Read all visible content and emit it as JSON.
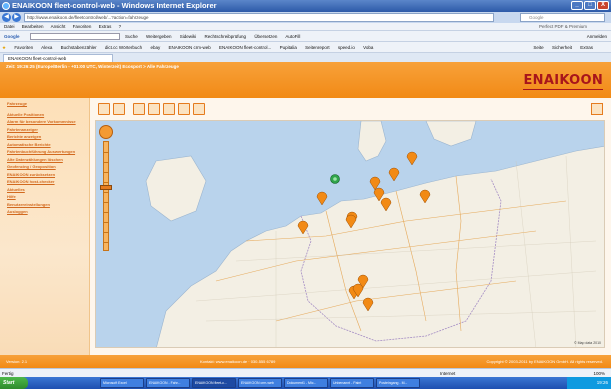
{
  "window": {
    "title": "ENAIKOON fleet-control-web - Windows Internet Explorer",
    "minimize": "_",
    "maximize": "□",
    "close": "X"
  },
  "address": {
    "url": "http://www.enaikoon.de/fleetcontrol/web/...?action=fahrzeuge",
    "search_placeholder": "Google"
  },
  "menu": {
    "items": [
      "Datei",
      "Bearbeiten",
      "Ansicht",
      "Favoriten",
      "Extras",
      "?"
    ],
    "pdf_label": "Perfect PDF & Premium"
  },
  "google_toolbar": {
    "label": "Google",
    "items": [
      "Suche",
      "Weitergeben",
      "Sidewiki",
      "Rechtschreibprüfung",
      "Übersetzen",
      "AutoFill"
    ],
    "signin": "Anmelden"
  },
  "favorites": {
    "items": [
      "Favoriten",
      "Alexa",
      "Buchstabenzähler",
      "dict.cc Wörterbuch",
      "ebay",
      "ENAIKOON crm-web",
      "ENAIKOON fleet-control...",
      "Pupitalia",
      "Seitenreport",
      "speed.io",
      "Voba"
    ],
    "right_items": [
      "Seite",
      "Sicherheit",
      "Extras"
    ]
  },
  "tab": {
    "label": "ENAIKOON fleet-control-web"
  },
  "header": {
    "time_text": "Zeit: 19:26:25 (Europe/Berlin - +01:00 UTC, Winterzeit)   Ecosport > Alle Fahrzeuge",
    "logo": "ENAIKOON"
  },
  "sidebar": {
    "items": [
      "Fahrzeuge",
      "Aktuelle Positionen",
      "Alarm für besondere Vorkommnisse",
      "Fahrtenanzeiger",
      "Berichte anzeigen",
      "Automatische Berichte",
      "Fahrtenbuchführung Auswertungen",
      "Alte Datenzählungen löschen",
      "Geofencing / Geoposition",
      "ENAIKOON zurücksetzen",
      "ENAIKOON host-checker",
      "Aktuelles",
      "Hilfe",
      "Benutzereinstellungen",
      "Ausloggen"
    ]
  },
  "map": {
    "zoom_out": "-",
    "scale_text": "© Map data 2010",
    "markers": [
      {
        "type": "pin",
        "color": "#f28a15"
      },
      {
        "type": "pin",
        "color": "#f28a15"
      },
      {
        "type": "pin",
        "color": "#f28a15"
      },
      {
        "type": "pin",
        "color": "#f28a15"
      },
      {
        "type": "pin",
        "color": "#f28a15"
      },
      {
        "type": "pin",
        "color": "#f28a15"
      },
      {
        "type": "pin",
        "color": "#f28a15"
      },
      {
        "type": "pin",
        "color": "#f28a15"
      },
      {
        "type": "pin",
        "color": "#f28a15"
      },
      {
        "type": "pin",
        "color": "#f28a15"
      },
      {
        "type": "pin",
        "color": "#f28a15"
      },
      {
        "type": "pin",
        "color": "#f28a15"
      },
      {
        "type": "pin",
        "color": "#f28a15"
      },
      {
        "type": "pin",
        "color": "#f28a15"
      },
      {
        "type": "current",
        "color": "#2fa44a"
      }
    ]
  },
  "footer": {
    "left": "Version: 2.1",
    "center": "Kontakt: www.enaikoon.de · 030-555 6789",
    "right": "Copyright © 2003-2011 by ENAIKOON GmbH. All rights reserved."
  },
  "status": {
    "left": "Fertig",
    "zone": "Internet",
    "zoom": "100%"
  },
  "taskbar": {
    "start": "Start",
    "tasks": [
      "Microsoft Excel",
      "ENAIKOON - Fahr...",
      "ENAIKOON fleet-c...",
      "ENAIKOON crm-web",
      "Dokument1 - Mic...",
      "Unbenannt - Paint",
      "Posteingang - M..."
    ],
    "clock": "19:26"
  },
  "colors": {
    "accent": "#f28a15",
    "brand_red": "#a8151b",
    "link": "#d2691e"
  }
}
